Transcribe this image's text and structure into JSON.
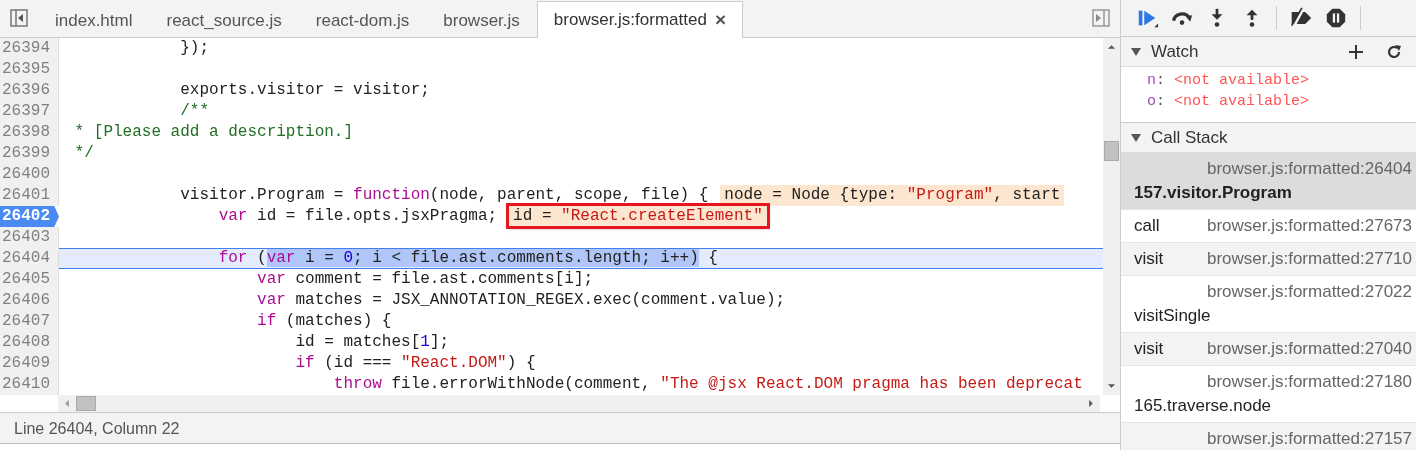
{
  "tabs": [
    {
      "label": "index.html",
      "selected": false
    },
    {
      "label": "react_source.js",
      "selected": false
    },
    {
      "label": "react-dom.js",
      "selected": false
    },
    {
      "label": "browser.js",
      "selected": false
    },
    {
      "label": "browser.js:formatted",
      "selected": true,
      "close": "×"
    }
  ],
  "lines": [
    {
      "number": "26394",
      "breakpoint": false,
      "current": false,
      "tokens": [
        {
          "kind": "plain",
          "text": "            });"
        }
      ]
    },
    {
      "number": "26395",
      "breakpoint": false,
      "current": false
    },
    {
      "number": "26396",
      "breakpoint": false,
      "current": false,
      "tokens": [
        {
          "kind": "plain",
          "text": "            exports.visitor = visitor;"
        }
      ]
    },
    {
      "number": "26397",
      "breakpoint": false,
      "current": false,
      "tokens": [
        {
          "kind": "comment",
          "text": "            /**"
        }
      ]
    },
    {
      "number": "26398",
      "breakpoint": false,
      "current": false,
      "tokens": [
        {
          "kind": "comment",
          "text": " * [Please add a description.]"
        }
      ]
    },
    {
      "number": "26399",
      "breakpoint": false,
      "current": false,
      "tokens": [
        {
          "kind": "comment",
          "text": " */"
        }
      ]
    },
    {
      "number": "26400",
      "breakpoint": false,
      "current": false
    },
    {
      "number": "26401",
      "breakpoint": false,
      "current": false,
      "tokens": [
        {
          "kind": "plain",
          "text": "            visitor.Program = "
        },
        {
          "kind": "keyword",
          "text": "function"
        },
        {
          "kind": "plain",
          "text": "(node, parent, scope, file) {"
        }
      ],
      "inline_value": {
        "boxed": false,
        "tokens": [
          {
            "kind": "plain",
            "text": "node = Node {type: "
          },
          {
            "kind": "string",
            "text": "\"Program\""
          },
          {
            "kind": "plain",
            "text": ", start"
          }
        ]
      }
    },
    {
      "number": "26402",
      "breakpoint": true,
      "current": false,
      "tokens": [
        {
          "kind": "keyword",
          "text": "                var"
        },
        {
          "kind": "plain",
          "text": " id = file.opts.jsxPragma;"
        }
      ],
      "inline_value": {
        "boxed": true,
        "tokens": [
          {
            "kind": "plain",
            "text": "id = "
          },
          {
            "kind": "string",
            "text": "\"React.createElement\""
          }
        ]
      }
    },
    {
      "number": "26403",
      "breakpoint": false,
      "current": false
    },
    {
      "number": "26404",
      "breakpoint": false,
      "current": true,
      "tokens": [
        {
          "kind": "keyword",
          "text": "                for"
        },
        {
          "kind": "plain",
          "text": " ("
        }
      ],
      "selected_tokens": [
        {
          "kind": "keyword",
          "text": "var"
        },
        {
          "kind": "plain",
          "text": " i = "
        },
        {
          "kind": "number",
          "text": "0"
        },
        {
          "kind": "plain",
          "text": "; i < file.ast.comments.length; i++)"
        }
      ],
      "tokens_after": [
        {
          "kind": "plain",
          "text": " {"
        }
      ]
    },
    {
      "number": "26405",
      "breakpoint": false,
      "current": false,
      "tokens": [
        {
          "kind": "keyword",
          "text": "                    var"
        },
        {
          "kind": "plain",
          "text": " comment = file.ast.comments[i];"
        }
      ]
    },
    {
      "number": "26406",
      "breakpoint": false,
      "current": false,
      "tokens": [
        {
          "kind": "keyword",
          "text": "                    var"
        },
        {
          "kind": "plain",
          "text": " matches = JSX_ANNOTATION_REGEX.exec(comment.value);"
        }
      ]
    },
    {
      "number": "26407",
      "breakpoint": false,
      "current": false,
      "tokens": [
        {
          "kind": "keyword",
          "text": "                    if"
        },
        {
          "kind": "plain",
          "text": " (matches) {"
        }
      ]
    },
    {
      "number": "26408",
      "breakpoint": false,
      "current": false,
      "tokens": [
        {
          "kind": "plain",
          "text": "                        id = matches["
        },
        {
          "kind": "number",
          "text": "1"
        },
        {
          "kind": "plain",
          "text": "];"
        }
      ]
    },
    {
      "number": "26409",
      "breakpoint": false,
      "current": false,
      "tokens": [
        {
          "kind": "keyword",
          "text": "                        if"
        },
        {
          "kind": "plain",
          "text": " (id === "
        },
        {
          "kind": "string",
          "text": "\"React.DOM\""
        },
        {
          "kind": "plain",
          "text": ") {"
        }
      ]
    },
    {
      "number": "26410",
      "breakpoint": false,
      "current": false,
      "tokens": [
        {
          "kind": "keyword",
          "text": "                            throw"
        },
        {
          "kind": "plain",
          "text": " file.errorWithNode(comment, "
        },
        {
          "kind": "string",
          "text": "\"The @jsx React.DOM pragma has been deprecat"
        }
      ]
    }
  ],
  "status_bar": "Line 26404, Column 22",
  "watch": {
    "title": "Watch",
    "items": [
      {
        "name": "n",
        "separator": ":",
        "value": "<not available>"
      },
      {
        "name": "o",
        "separator": ":",
        "value": "<not available>"
      }
    ]
  },
  "call_stack": {
    "title": "Call Stack",
    "frames": [
      {
        "function": "157.visitor.Program",
        "location": "browser.js:formatted:26404",
        "selected": true
      },
      {
        "function": "call",
        "location": "browser.js:formatted:27673",
        "selected": false
      },
      {
        "function": "visit",
        "location": "browser.js:formatted:27710",
        "selected": false
      },
      {
        "function": "visitSingle",
        "location": "browser.js:formatted:27022",
        "selected": false
      },
      {
        "function": "visit",
        "location": "browser.js:formatted:27040",
        "selected": false
      },
      {
        "function": "165.traverse.node",
        "location": "browser.js:formatted:27180",
        "selected": false
      },
      {
        "location": "browser.js:formatted:27157",
        "selected": false
      }
    ]
  }
}
